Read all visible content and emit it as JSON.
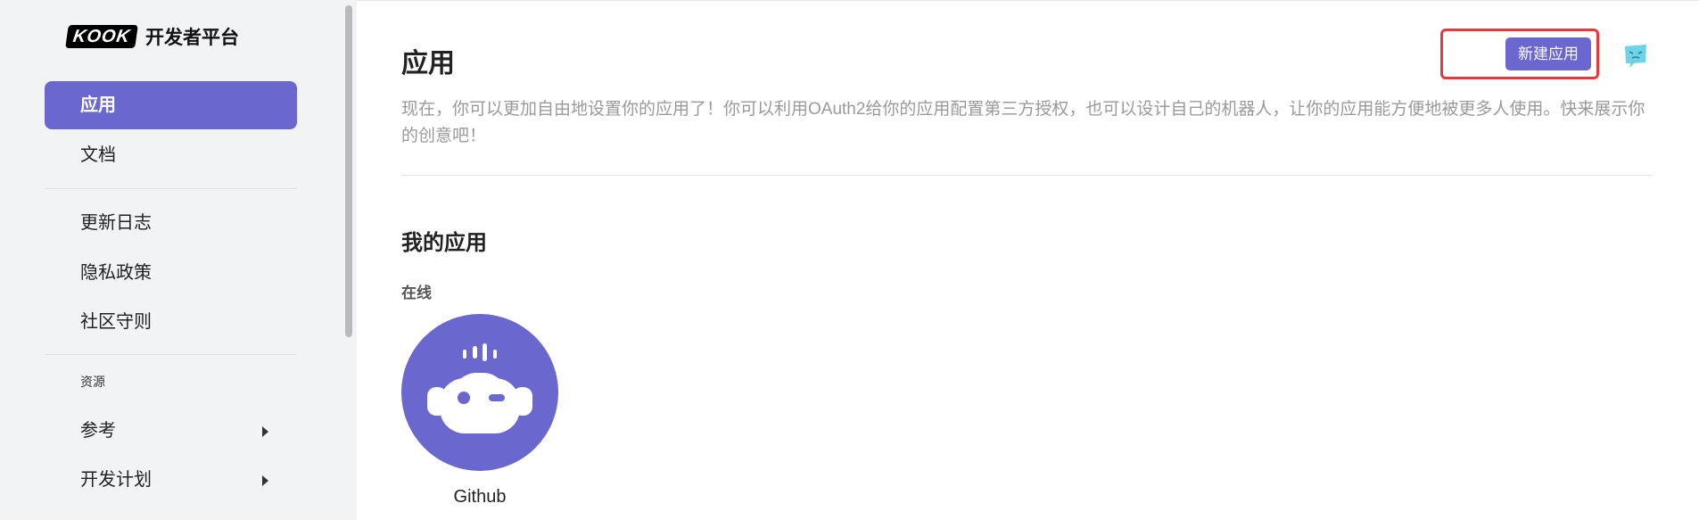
{
  "sidebar": {
    "logo_mark": "KOOK",
    "logo_text": "开发者平台",
    "items": [
      {
        "label": "应用"
      },
      {
        "label": "文档"
      },
      {
        "label": "更新日志"
      },
      {
        "label": "隐私政策"
      },
      {
        "label": "社区守则"
      }
    ],
    "section_label": "资源",
    "expandable_items": [
      {
        "label": "参考"
      },
      {
        "label": "开发计划"
      }
    ]
  },
  "main": {
    "title": "应用",
    "description": "现在，你可以更加自由地设置你的应用了！你可以利用OAuth2给你的应用配置第三方授权，也可以设计自己的机器人，让你的应用能方便地被更多人使用。快来展示你的创意吧！",
    "new_app_button": "新建应用",
    "my_apps_title": "我的应用",
    "online_label": "在线",
    "apps": [
      {
        "name": "Github",
        "icon": "robot-icon"
      }
    ]
  },
  "colors": {
    "accent": "#6a67ce",
    "sidebar_bg": "#f2f3f5",
    "highlight_border": "#e8383d",
    "helper_icon": "#6dd3e6"
  }
}
